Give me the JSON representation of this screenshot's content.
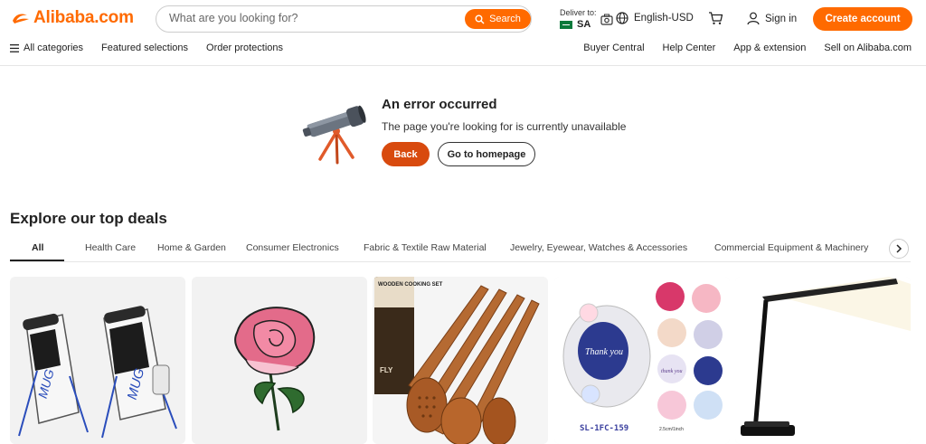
{
  "header": {
    "logo_text": "Alibaba.com",
    "search_placeholder": "What are you looking for?",
    "search_button": "Search",
    "deliver_label": "Deliver to:",
    "deliver_country": "SA",
    "language": "English-USD",
    "sign_in": "Sign in",
    "create_account": "Create account"
  },
  "nav": {
    "all_categories": "All categories",
    "featured": "Featured selections",
    "order_protections": "Order protections",
    "buyer_central": "Buyer Central",
    "help_center": "Help Center",
    "app_extension": "App & extension",
    "sell": "Sell on Alibaba.com"
  },
  "error": {
    "title": "An error occurred",
    "message": "The page you're looking for is currently unavailable",
    "back": "Back",
    "home": "Go to homepage"
  },
  "deals": {
    "title": "Explore our top deals",
    "tabs": [
      "All",
      "Health Care",
      "Home & Garden",
      "Consumer Electronics",
      "Fabric & Textile Raw Material",
      "Jewelry, Eyewear, Watches & Accessories",
      "Commercial Equipment & Machinery"
    ],
    "product_text": {
      "box_label": "WOODEN COOKING SET",
      "box_brand": "FLY",
      "sticker_roll": "Thank you",
      "sticker_code": "SL-1FC-159",
      "sticker_size": "2.5cm/1inch",
      "sticker_small": "thank you",
      "bag_brand": "MUG"
    }
  },
  "colors": {
    "brand": "#ff6a00",
    "back_button": "#d84a0e"
  }
}
